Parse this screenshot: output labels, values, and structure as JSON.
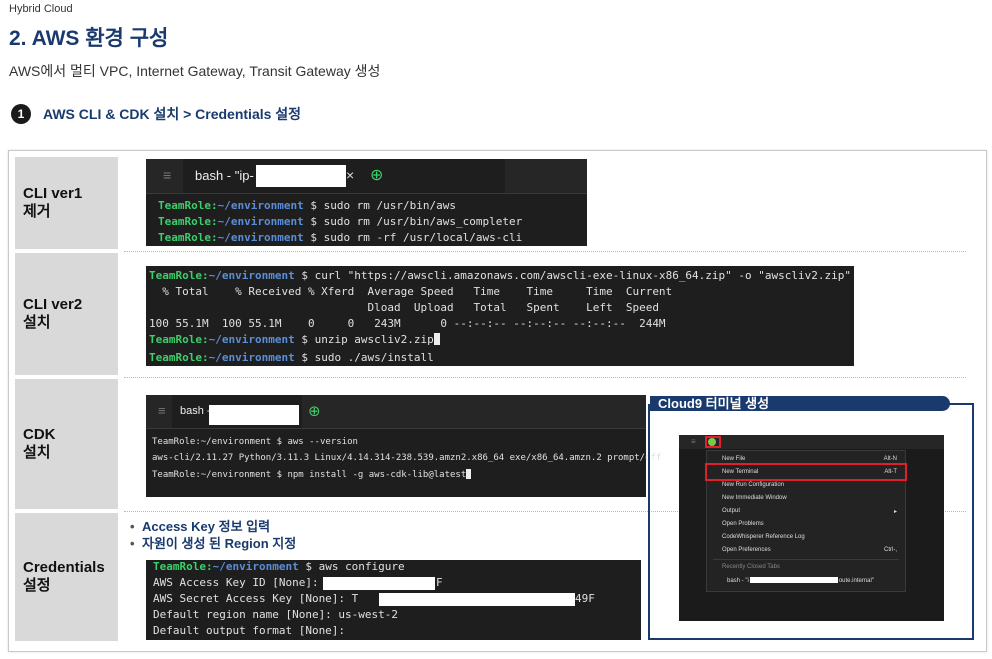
{
  "header": {
    "brand": "Hybrid Cloud",
    "title": "2. AWS 환경 구성",
    "subtitle": "AWS에서 멀티 VPC, Internet Gateway, Transit Gateway 생성"
  },
  "step": {
    "number": "1",
    "label": "AWS CLI & CDK 설치 > Credentials 설정"
  },
  "rows": [
    {
      "label_lines": [
        "CLI ver1",
        "제거"
      ]
    },
    {
      "label_lines": [
        "CLI ver2",
        "설치"
      ]
    },
    {
      "label_lines": [
        "CDK",
        "설치"
      ]
    },
    {
      "label_lines": [
        "Credentials",
        "설정"
      ]
    }
  ],
  "term1": {
    "menu_glyph": "≡",
    "tab_label": "bash - \"ip-",
    "close_glyph": "×",
    "add_glyph": "⊕",
    "prompt": "TeamRole:",
    "cwd": "~/environment",
    "lines": [
      "$ sudo rm /usr/bin/aws",
      "$ sudo rm /usr/bin/aws_completer",
      "$ sudo rm -rf /usr/local/aws-cli"
    ]
  },
  "term2": {
    "prompt": "TeamRole:",
    "cwd": "~/environment",
    "cmd1": "$ curl \"https://awscli.amazonaws.com/awscli-exe-linux-x86_64.zip\" -o \"awscliv2.zip\"",
    "out1": "  % Total    % Received % Xferd  Average Speed   Time    Time     Time  Current",
    "out2": "                                 Dload  Upload   Total   Spent    Left  Speed",
    "out3": "100 55.1M  100 55.1M    0     0   243M      0 --:--:-- --:--:-- --:--:--  244M",
    "cmd2": "$ unzip awscliv2.zip",
    "cmd3": "$ sudo ./aws/install"
  },
  "term3": {
    "menu_glyph": "≡",
    "tab_label": "bash -",
    "add_glyph": "⊕",
    "l1": "TeamRole:~/environment $ aws --version",
    "l2": "aws-cli/2.11.27 Python/3.11.3 Linux/4.14.314-238.539.amzn2.x86_64 exe/x86_64.amzn.2 prompt/off",
    "l3": "TeamRole:~/environment $ npm install -g aws-cdk-lib@latest"
  },
  "credentials": {
    "bullets": [
      "Access Key 정보 입력",
      "자원이 생성 된 Region 지정"
    ],
    "bullet_glyph": "•",
    "prompt": "TeamRole:",
    "cwd": "~/environment",
    "cmd": "$ aws configure",
    "l1a": "AWS Access Key ID [None]: A",
    "l1b": "F",
    "l2a": "AWS Secret Access Key [None]: T",
    "l2b": "49F",
    "l3": "Default region name [None]: us-west-2",
    "l4": "Default output format [None]:"
  },
  "cloud9": {
    "title": "Cloud9 터미널 생성",
    "menu": [
      {
        "label": "New File",
        "shortcut": "Alt-N"
      },
      {
        "label": "New Terminal",
        "shortcut": "Alt-T"
      },
      {
        "label": "New Run Configuration",
        "shortcut": ""
      },
      {
        "label": "New Immediate Window",
        "shortcut": ""
      },
      {
        "label": "Output",
        "shortcut": "▸"
      },
      {
        "label": "Open Problems",
        "shortcut": ""
      },
      {
        "label": "CodeWhisperer Reference Log",
        "shortcut": ""
      },
      {
        "label": "Open Preferences",
        "shortcut": "Ctrl-,"
      }
    ],
    "recent_header": "Recently Closed Tabs",
    "recent_item_a": "bash - \"i",
    "recent_item_b": "oute.internal\""
  },
  "colors": {
    "accent": "#1a3a6e",
    "highlight": "#e0202a",
    "prompt_green": "#3ccf6a",
    "cwd_blue": "#5b8dd6"
  }
}
